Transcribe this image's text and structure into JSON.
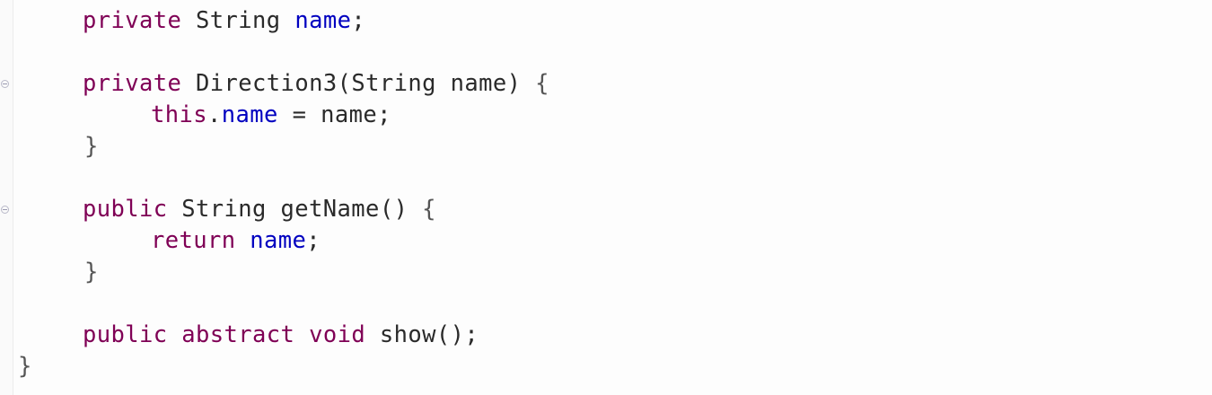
{
  "code": {
    "line1": {
      "kw": "private",
      "type": "String",
      "field": "name",
      "end": ";"
    },
    "line2": {
      "kw": "private",
      "decl": "Direction3(String name)",
      "brace": "{"
    },
    "line3": {
      "kw": "this",
      "dot": ".",
      "field": "name",
      "rest": "= name;"
    },
    "line4": {
      "brace": "}"
    },
    "line5": {
      "kw": "public",
      "decl": "String getName()",
      "brace": "{"
    },
    "line6": {
      "kw": "return",
      "field": "name",
      "end": ";"
    },
    "line7": {
      "brace": "}"
    },
    "line8": {
      "kw1": "public",
      "kw2": "abstract",
      "kw3": "void",
      "decl": "show();"
    },
    "line9": {
      "brace": "}"
    }
  },
  "gutter": {
    "fold_icons": [
      "fold-collapse-icon",
      "fold-collapse-icon"
    ]
  },
  "colors": {
    "keyword": "#7f0055",
    "field": "#0000c0",
    "text": "#2a2a2a",
    "background": "#fdfdfd"
  }
}
